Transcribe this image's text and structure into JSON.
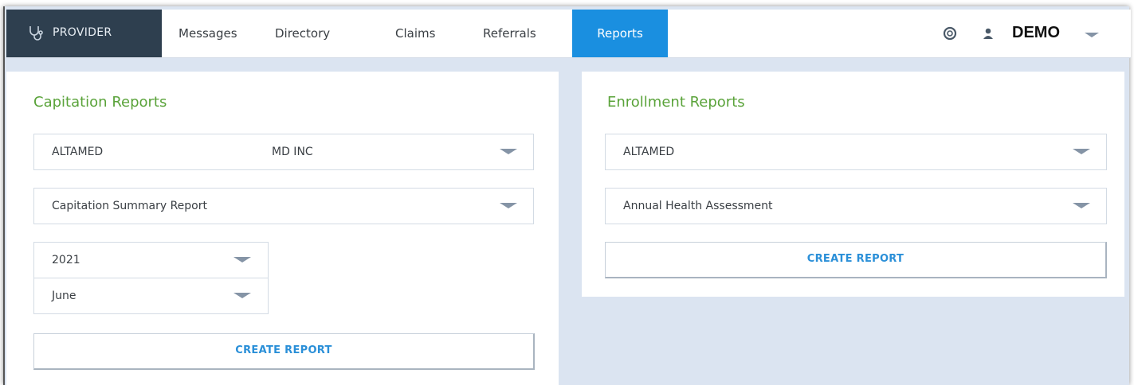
{
  "nav": {
    "brand": "PROVIDER",
    "items": [
      {
        "label": "Messages"
      },
      {
        "label": "Directory"
      },
      {
        "label": "Claims"
      },
      {
        "label": "Referrals"
      },
      {
        "label": "Reports",
        "active": true
      }
    ],
    "user": "DEMO"
  },
  "capitation": {
    "title": "Capitation Reports",
    "group_select": {
      "value": "ALTAMED",
      "value2": "MD INC"
    },
    "report_select": {
      "value": "Capitation Summary Report"
    },
    "year_select": {
      "value": "2021"
    },
    "month_select": {
      "value": "June"
    },
    "create_label": "CREATE REPORT"
  },
  "enrollment": {
    "title": "Enrollment Reports",
    "group_select": {
      "value": "ALTAMED"
    },
    "report_select": {
      "value": "Annual Health Assessment"
    },
    "create_label": "CREATE REPORT"
  },
  "colors": {
    "brand_bg": "#2e3f4f",
    "active_tab": "#1a8fe0",
    "title_green": "#5aa33a",
    "button_text": "#2a8fd8",
    "page_bg": "#dbe4f1"
  }
}
